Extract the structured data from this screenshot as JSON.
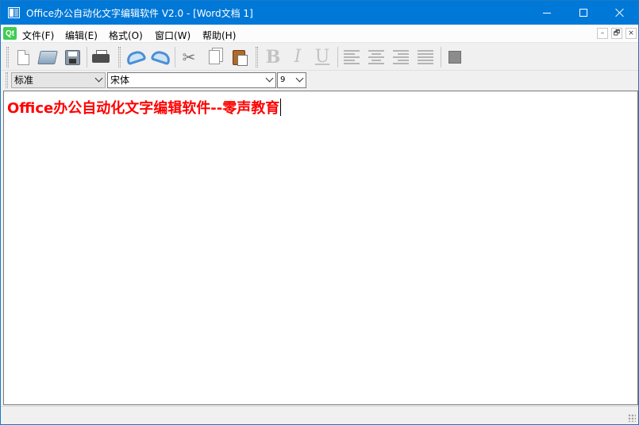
{
  "window": {
    "title": "Office办公自动化文字编辑软件 V2.0 - [Word文档 1]"
  },
  "menubar": {
    "items": [
      {
        "label": "文件(F)"
      },
      {
        "label": "编辑(E)"
      },
      {
        "label": "格式(O)"
      },
      {
        "label": "窗口(W)"
      },
      {
        "label": "帮助(H)"
      }
    ],
    "qt_logo": "Qt",
    "mdi_minimize": "–",
    "mdi_restore": "🗗",
    "mdi_close": "×"
  },
  "toolbar": {
    "icons": [
      "new-document-icon",
      "open-folder-icon",
      "save-icon",
      "print-icon",
      "undo-icon",
      "redo-icon",
      "cut-icon",
      "copy-icon",
      "paste-icon",
      "bold-icon",
      "italic-icon",
      "underline-icon",
      "align-left-icon",
      "align-center-icon",
      "align-right-icon",
      "justify-icon",
      "text-color-icon"
    ],
    "bold_glyph": "B",
    "italic_glyph": "I",
    "underline_glyph": "U",
    "cut_glyph": "✂",
    "disabled_color": "#c3c3c3",
    "accent": "#4a8fd6"
  },
  "formatbar": {
    "style_value": "标准",
    "font_value": "宋体",
    "size_value": "9"
  },
  "document": {
    "text": "Office办公自动化文字编辑软件--零声教育",
    "text_color": "#ff0000"
  },
  "colors": {
    "titlebar": "#0078d7",
    "window_bg": "#f0f0f0",
    "qt_green": "#41cd52"
  }
}
